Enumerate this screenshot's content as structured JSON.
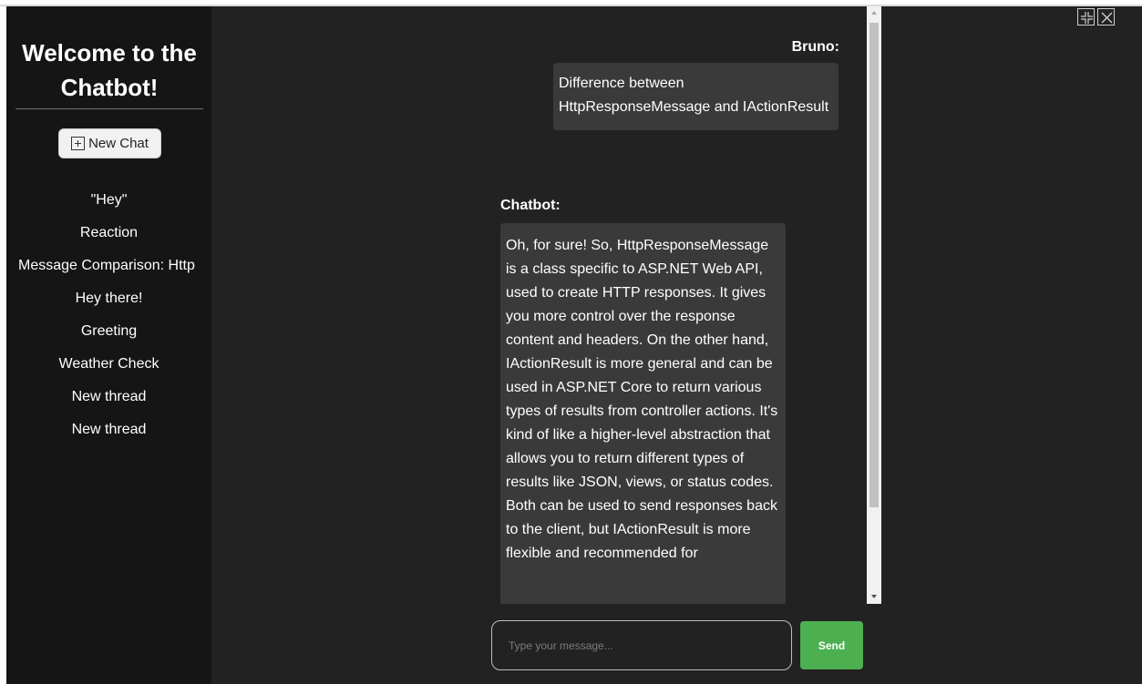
{
  "sidebar": {
    "title": "Welcome to the Chatbot!",
    "new_chat_label": "New Chat",
    "threads": [
      "\"Hey\"",
      "Reaction",
      "Message Comparison: Http",
      "Hey there!",
      "Greeting",
      "Weather Check",
      "New thread",
      "New thread"
    ]
  },
  "messages": [
    {
      "sender": "Bruno:",
      "text": "Difference between HttpResponseMessage and IActionResult"
    },
    {
      "sender": "Chatbot:",
      "text": "Oh, for sure! So, HttpResponseMessage is a class specific to ASP.NET Web API, used to create HTTP responses. It gives you more control over the response content and headers. On the other hand, IActionResult is more general and can be used in ASP.NET Core to return various types of results from controller actions. It's kind of like a higher-level abstraction that allows you to return different types of results like JSON, views, or status codes. Both can be used to send responses back to the client, but IActionResult is more flexible and recommended for"
    }
  ],
  "input": {
    "placeholder": "Type your message...",
    "value": ""
  },
  "send_label": "Send",
  "icons": {
    "new_chat": "plus-square-icon",
    "exit_fullscreen": "collapse-icon",
    "close": "close-icon"
  },
  "colors": {
    "send": "#4caf50",
    "sidebar": "#151515",
    "background": "#222222",
    "bubble": "#3a3a3a"
  }
}
